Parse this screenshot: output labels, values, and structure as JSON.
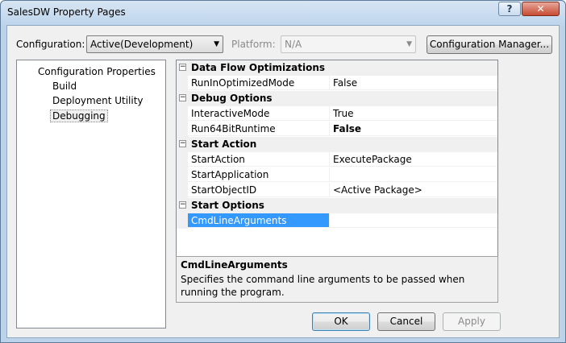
{
  "window": {
    "title": "SalesDW Property Pages",
    "help_label": "?",
    "close_label": "✕"
  },
  "toolbar": {
    "configuration_label": "Configuration:",
    "configuration_value": "Active(Development)",
    "platform_label": "Platform:",
    "platform_value": "N/A",
    "config_manager_label": "Configuration Manager..."
  },
  "tree": {
    "root": "Configuration Properties",
    "items": [
      "Build",
      "Deployment Utility",
      "Debugging"
    ],
    "selected": "Debugging"
  },
  "grid": {
    "categories": [
      {
        "name": "Data Flow Optimizations",
        "properties": [
          {
            "name": "RunInOptimizedMode",
            "value": "False"
          }
        ]
      },
      {
        "name": "Debug Options",
        "properties": [
          {
            "name": "InteractiveMode",
            "value": "True"
          },
          {
            "name": "Run64BitRuntime",
            "value": "False"
          }
        ]
      },
      {
        "name": "Start Action",
        "properties": [
          {
            "name": "StartAction",
            "value": "ExecutePackage"
          },
          {
            "name": "StartApplication",
            "value": ""
          },
          {
            "name": "StartObjectID",
            "value": "<Active Package>"
          }
        ]
      },
      {
        "name": "Start Options",
        "properties": [
          {
            "name": "CmdLineArguments",
            "value": ""
          }
        ]
      }
    ],
    "collapse_glyph": "−"
  },
  "description": {
    "title": "CmdLineArguments",
    "text": "Specifies the command line arguments to be passed when running the program."
  },
  "buttons": {
    "ok": "OK",
    "cancel": "Cancel",
    "apply": "Apply"
  },
  "icons": {
    "dropdown": "▼"
  }
}
